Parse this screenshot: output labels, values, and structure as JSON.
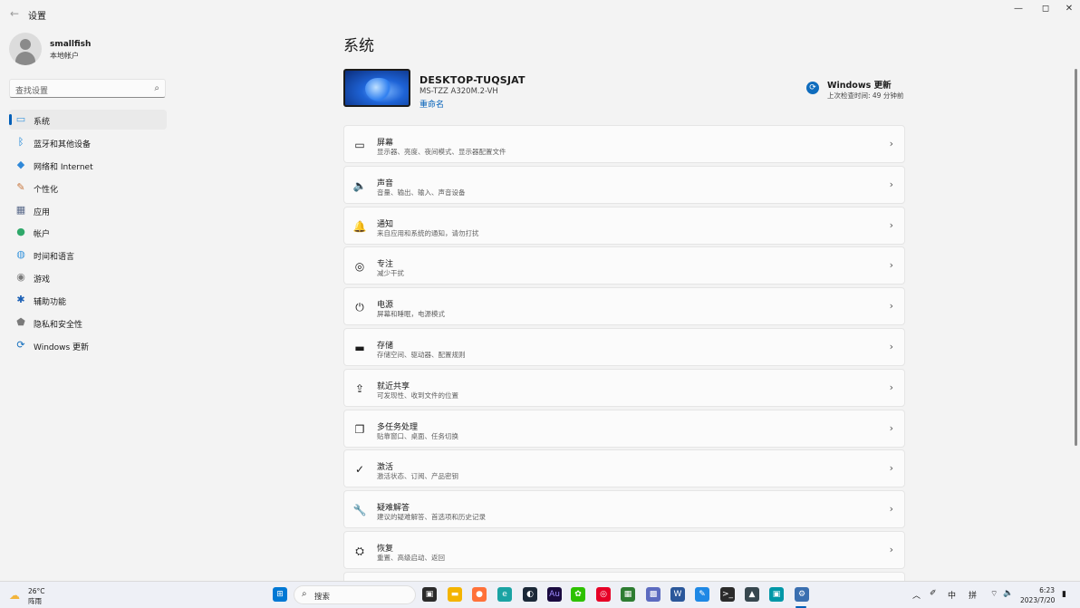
{
  "window": {
    "title": "设置",
    "back_glyph": "←",
    "min_glyph": "—",
    "max_glyph": "◻",
    "close_glyph": "✕"
  },
  "profile": {
    "name": "smallfish",
    "account_type": "本地帐户"
  },
  "search": {
    "placeholder": "查找设置",
    "icon": "search-icon"
  },
  "sidebar": {
    "items": [
      {
        "label": "系统",
        "icon": "system-icon",
        "active": true,
        "glyph": "▭",
        "color": "#3a96dd"
      },
      {
        "label": "蓝牙和其他设备",
        "icon": "bluetooth-icon",
        "glyph": "ᛒ",
        "color": "#0078d4"
      },
      {
        "label": "网络和 Internet",
        "icon": "wifi-icon",
        "glyph": "◆",
        "color": "#2f88d8"
      },
      {
        "label": "个性化",
        "icon": "brush-icon",
        "glyph": "✎",
        "color": "#c8753b"
      },
      {
        "label": "应用",
        "icon": "apps-icon",
        "glyph": "▦",
        "color": "#5a6a8a"
      },
      {
        "label": "帐户",
        "icon": "account-icon",
        "glyph": "●",
        "color": "#2fa86a"
      },
      {
        "label": "时间和语言",
        "icon": "globe-clock-icon",
        "glyph": "◍",
        "color": "#3a96dd"
      },
      {
        "label": "游戏",
        "icon": "gamepad-icon",
        "glyph": "◉",
        "color": "#7a7a7a"
      },
      {
        "label": "辅助功能",
        "icon": "accessibility-icon",
        "glyph": "✱",
        "color": "#1a5fb4"
      },
      {
        "label": "隐私和安全性",
        "icon": "shield-icon",
        "glyph": "⬟",
        "color": "#7a7a7a"
      },
      {
        "label": "Windows 更新",
        "icon": "windows-update-icon",
        "glyph": "⟳",
        "color": "#0f6cbd"
      }
    ]
  },
  "main": {
    "page_title": "系统",
    "device": {
      "name": "DESKTOP-TUQSJAT",
      "model": "MS-TZZ A320M.2-VH",
      "rename": "重命名"
    },
    "windows_update": {
      "title": "Windows 更新",
      "subtitle": "上次检查时间: 49 分钟前"
    },
    "cards": [
      {
        "title": "屏幕",
        "desc": "显示器、亮度、夜间模式、显示器配置文件",
        "icon": "display-icon",
        "glyph": "▭"
      },
      {
        "title": "声音",
        "desc": "音量、输出、输入、声音设备",
        "icon": "speaker-icon",
        "glyph": "🔈"
      },
      {
        "title": "通知",
        "desc": "来自应用和系统的通知，请勿打扰",
        "icon": "bell-icon",
        "glyph": "🔔"
      },
      {
        "title": "专注",
        "desc": "减少干扰",
        "icon": "focus-icon",
        "glyph": "◎"
      },
      {
        "title": "电源",
        "desc": "屏幕和睡眠，电源模式",
        "icon": "power-icon",
        "glyph": "⏻"
      },
      {
        "title": "存储",
        "desc": "存储空间、驱动器、配置规则",
        "icon": "storage-icon",
        "glyph": "▬"
      },
      {
        "title": "就近共享",
        "desc": "可发现性、收到文件的位置",
        "icon": "share-icon",
        "glyph": "⇪"
      },
      {
        "title": "多任务处理",
        "desc": "贴靠窗口、桌面、任务切换",
        "icon": "multitask-icon",
        "glyph": "❐"
      },
      {
        "title": "激活",
        "desc": "激活状态、订阅、产品密钥",
        "icon": "check-circle-icon",
        "glyph": "✓"
      },
      {
        "title": "疑难解答",
        "desc": "建议的疑难解答、首选项和历史记录",
        "icon": "wrench-icon",
        "glyph": "🔧"
      },
      {
        "title": "恢复",
        "desc": "重置、高级启动、返回",
        "icon": "recovery-icon",
        "glyph": "⛭"
      }
    ],
    "chevron": "›"
  },
  "taskbar": {
    "weather_temp": "26°C",
    "weather_cond": "阵雨",
    "search_placeholder": "搜索",
    "tray_ime_lang": "中",
    "tray_ime_mode": "拼",
    "time": "6:23",
    "date": "2023/7/20",
    "apps": [
      {
        "name": "start-icon",
        "glyph": "⊞",
        "bg": "#0078d4",
        "fg": "#ffffff"
      },
      {
        "name": "task-view-icon",
        "glyph": "▣",
        "bg": "#2b2b2b",
        "fg": "#ffffff"
      },
      {
        "name": "file-explorer-icon",
        "glyph": "▬",
        "bg": "#f4b400",
        "fg": "#ffffff"
      },
      {
        "name": "firefox-icon",
        "glyph": "●",
        "bg": "#ff7139",
        "fg": "#ffffff"
      },
      {
        "name": "edge-icon",
        "glyph": "e",
        "bg": "#1aa3a3",
        "fg": "#ffffff"
      },
      {
        "name": "steam-icon",
        "glyph": "◐",
        "bg": "#1b2838",
        "fg": "#ffffff"
      },
      {
        "name": "audition-icon",
        "glyph": "Au",
        "bg": "#1a0b40",
        "fg": "#9f8cff"
      },
      {
        "name": "wechat-icon",
        "glyph": "✿",
        "bg": "#2dc100",
        "fg": "#ffffff"
      },
      {
        "name": "netease-music-icon",
        "glyph": "◎",
        "bg": "#e60026",
        "fg": "#ffffff"
      },
      {
        "name": "app-green-icon",
        "glyph": "▦",
        "bg": "#2e7d32",
        "fg": "#ffffff"
      },
      {
        "name": "chart-app-icon",
        "glyph": "▩",
        "bg": "#5c6bc0",
        "fg": "#ffffff"
      },
      {
        "name": "word-icon",
        "glyph": "W",
        "bg": "#2b579a",
        "fg": "#ffffff"
      },
      {
        "name": "paint-icon",
        "glyph": "✎",
        "bg": "#1e88e5",
        "fg": "#ffffff"
      },
      {
        "name": "terminal-icon",
        "glyph": ">_",
        "bg": "#2b2b2b",
        "fg": "#ffffff"
      },
      {
        "name": "pin-app-icon",
        "glyph": "▲",
        "bg": "#37474f",
        "fg": "#ffffff"
      },
      {
        "name": "remote-desktop-icon",
        "glyph": "▣",
        "bg": "#0097a7",
        "fg": "#ffffff"
      },
      {
        "name": "settings-icon",
        "glyph": "⚙",
        "bg": "#3a6fb0",
        "fg": "#ffffff"
      }
    ]
  }
}
